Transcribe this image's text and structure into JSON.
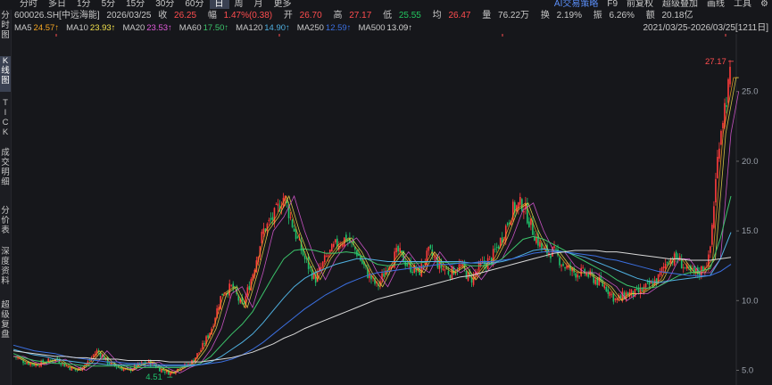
{
  "tabs": [
    "分时",
    "多日",
    "1分",
    "5分",
    "15分",
    "30分",
    "60分",
    "日",
    "周",
    "月",
    "更多"
  ],
  "active_tab": "日",
  "right_menu": {
    "ai": "AI交易策略",
    "f9": "F9",
    "fuquan": "前复权",
    "overlay": "超级叠加",
    "draw": "画线",
    "tools": "工具",
    "settings_icon": "gear-icon"
  },
  "sidebar": [
    {
      "label": "分时图",
      "active": false
    },
    {
      "label": "K线图",
      "active": true
    },
    {
      "label": "TICK",
      "active": false
    },
    {
      "label": "成交明细",
      "active": false
    },
    {
      "label": "分价表",
      "active": false
    },
    {
      "label": "深度资料",
      "active": false
    },
    {
      "label": "超级复盘",
      "active": false
    }
  ],
  "info": {
    "code": "600026.SH[中远海能]",
    "date": "2026/03/25",
    "close_label": "收",
    "close": "26.25",
    "change_label": "幅",
    "change": "1.47%(0.38)",
    "open_label": "开",
    "open": "26.70",
    "high_label": "高",
    "high": "27.17",
    "low_label": "低",
    "low": "25.55",
    "avg_label": "均",
    "avg": "26.47",
    "volume_label": "量",
    "volume": "76.22万",
    "turnover_label": "换",
    "turnover": "2.19%",
    "amplitude_label": "振",
    "amplitude": "6.26%",
    "amount_label": "额",
    "amount": "20.18亿"
  },
  "ma": [
    {
      "label": "MA5",
      "value": "24.57↑",
      "color": "#f5a623"
    },
    {
      "label": "MA10",
      "value": "23.93↑",
      "color": "#f2e14c"
    },
    {
      "label": "MA20",
      "value": "23.53↑",
      "color": "#e45cdd"
    },
    {
      "label": "MA60",
      "value": "17.50↑",
      "color": "#3cc46b"
    },
    {
      "label": "MA120",
      "value": "14.90↑",
      "color": "#4fb0e0"
    },
    {
      "label": "MA250",
      "value": "12.59↑",
      "color": "#3b6fe0"
    },
    {
      "label": "MA500",
      "value": "13.09↑",
      "color": "#d8d8d8"
    }
  ],
  "range": "2021/03/25-2026/03/25[1211日]",
  "chart_data": {
    "type": "candlestick",
    "y_ticks": [
      "25.0",
      "20.0",
      "15.0",
      "10.0",
      "5.0"
    ],
    "y_ticks_values": [
      25,
      20,
      15,
      10,
      5
    ],
    "ylim": [
      4.2,
      28.5
    ],
    "max_label": "27.17",
    "min_label": "4.51",
    "close_series": [
      6.0,
      5.6,
      5.4,
      5.6,
      5.8,
      5.3,
      5.0,
      5.5,
      6.4,
      5.6,
      5.2,
      5.0,
      5.4,
      5.6,
      5.1,
      4.8,
      5.2,
      5.5,
      6.5,
      8.0,
      10.5,
      11.0,
      9.5,
      12.0,
      15.0,
      16.0,
      17.5,
      15.0,
      13.0,
      11.5,
      13.0,
      14.0,
      14.5,
      13.5,
      12.0,
      11.0,
      12.5,
      13.5,
      12.5,
      12.0,
      13.5,
      12.5,
      12.0,
      12.5,
      11.5,
      12.5,
      13.0,
      14.5,
      16.5,
      17.0,
      15.0,
      13.5,
      13.5,
      12.5,
      12.0,
      12.0,
      11.5,
      11.0,
      10.0,
      10.5,
      10.5,
      11.0,
      11.5,
      13.0,
      13.0,
      12.0,
      12.0,
      13.0,
      22.0,
      26.0
    ],
    "ma_series": [
      {
        "name": "MA60",
        "color": "#3cc46b",
        "values": [
          6.2,
          5.9,
          5.7,
          5.6,
          5.5,
          5.5,
          5.4,
          5.3,
          5.3,
          5.3,
          5.3,
          5.3,
          5.2,
          5.2,
          5.2,
          5.2,
          5.2,
          5.3,
          5.5,
          6.0,
          6.8,
          7.6,
          8.3,
          9.2,
          10.5,
          11.8,
          13.0,
          13.6,
          13.7,
          13.6,
          13.4,
          13.4,
          13.5,
          13.4,
          13.0,
          12.6,
          12.5,
          12.6,
          12.7,
          12.7,
          12.8,
          12.8,
          12.7,
          12.7,
          12.5,
          12.5,
          12.6,
          13.0,
          13.7,
          14.4,
          14.6,
          14.4,
          14.0,
          13.6,
          13.2,
          12.8,
          12.4,
          12.0,
          11.5,
          11.1,
          10.9,
          10.9,
          11.0,
          11.4,
          11.8,
          12.0,
          12.1,
          12.3,
          14.5,
          17.5
        ]
      },
      {
        "name": "MA120",
        "color": "#4fb0e0",
        "values": [
          6.5,
          6.3,
          6.1,
          6.0,
          5.8,
          5.7,
          5.6,
          5.5,
          5.5,
          5.4,
          5.4,
          5.4,
          5.4,
          5.3,
          5.3,
          5.3,
          5.3,
          5.3,
          5.4,
          5.6,
          6.0,
          6.5,
          7.0,
          7.6,
          8.4,
          9.3,
          10.2,
          11.0,
          11.6,
          12.0,
          12.3,
          12.6,
          12.8,
          13.0,
          13.0,
          12.9,
          12.8,
          12.8,
          12.8,
          12.8,
          12.8,
          12.8,
          12.8,
          12.8,
          12.7,
          12.7,
          12.7,
          12.8,
          13.0,
          13.3,
          13.6,
          13.7,
          13.6,
          13.5,
          13.3,
          13.1,
          12.8,
          12.5,
          12.2,
          11.9,
          11.6,
          11.4,
          11.3,
          11.4,
          11.5,
          11.6,
          11.7,
          11.8,
          13.0,
          14.9
        ]
      },
      {
        "name": "MA250",
        "color": "#3b6fe0",
        "values": [
          6.8,
          6.6,
          6.4,
          6.3,
          6.2,
          6.0,
          5.9,
          5.8,
          5.7,
          5.6,
          5.6,
          5.5,
          5.5,
          5.5,
          5.4,
          5.4,
          5.4,
          5.4,
          5.4,
          5.5,
          5.6,
          5.8,
          6.1,
          6.5,
          7.0,
          7.6,
          8.2,
          8.8,
          9.4,
          9.9,
          10.4,
          10.8,
          11.2,
          11.5,
          11.8,
          12.0,
          12.1,
          12.2,
          12.3,
          12.4,
          12.5,
          12.6,
          12.6,
          12.7,
          12.7,
          12.8,
          12.8,
          12.9,
          13.0,
          13.2,
          13.4,
          13.5,
          13.5,
          13.5,
          13.4,
          13.3,
          13.2,
          13.0,
          12.9,
          12.7,
          12.5,
          12.3,
          12.1,
          12.0,
          11.9,
          11.8,
          11.8,
          11.8,
          12.1,
          12.6
        ]
      },
      {
        "name": "MA500",
        "color": "#d8d8d8",
        "values": [
          6.4,
          6.3,
          6.2,
          6.1,
          6.0,
          6.0,
          5.9,
          5.9,
          5.8,
          5.8,
          5.8,
          5.7,
          5.7,
          5.7,
          5.7,
          5.6,
          5.6,
          5.6,
          5.6,
          5.7,
          5.8,
          5.9,
          6.1,
          6.3,
          6.6,
          6.9,
          7.3,
          7.6,
          8.0,
          8.3,
          8.6,
          8.9,
          9.2,
          9.5,
          9.8,
          10.1,
          10.3,
          10.5,
          10.7,
          10.9,
          11.1,
          11.3,
          11.5,
          11.7,
          11.8,
          12.0,
          12.2,
          12.4,
          12.6,
          12.8,
          13.0,
          13.2,
          13.4,
          13.5,
          13.6,
          13.6,
          13.6,
          13.5,
          13.5,
          13.4,
          13.3,
          13.2,
          13.1,
          13.0,
          13.0,
          12.9,
          12.9,
          12.9,
          13.0,
          13.1
        ]
      }
    ]
  }
}
